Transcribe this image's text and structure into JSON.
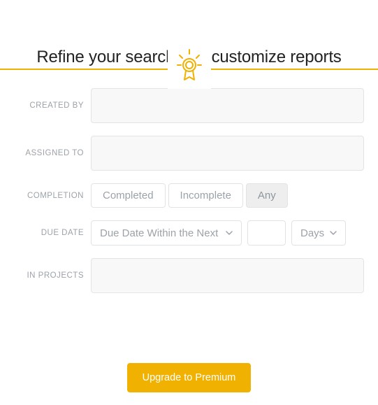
{
  "title": "Refine your search and customize reports",
  "labels": {
    "created_by": "CREATED BY",
    "assigned_to": "ASSIGNED TO",
    "completion": "COMPLETION",
    "due_date": "DUE DATE",
    "in_projects": "IN PROJECTS"
  },
  "fields": {
    "created_by": "",
    "assigned_to": "",
    "in_projects": "",
    "due_number": ""
  },
  "completion": {
    "options": [
      "Completed",
      "Incomplete",
      "Any"
    ],
    "selected": "Any"
  },
  "due": {
    "range_label": "Due Date Within the Next",
    "unit_label": "Days"
  },
  "cta": "Upgrade to Premium",
  "colors": {
    "accent": "#f1b100"
  }
}
